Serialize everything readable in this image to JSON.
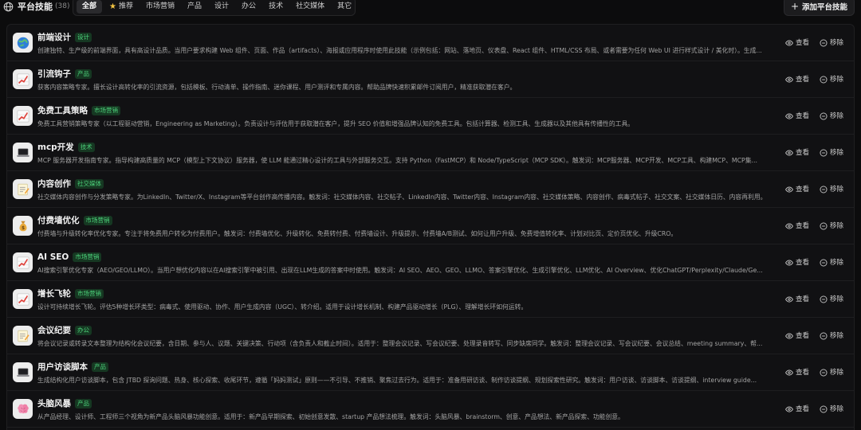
{
  "header": {
    "title": "平台技能",
    "count": "(38)",
    "add_button_label": "添加平台技能"
  },
  "tabs": [
    {
      "label": "全部",
      "active": true,
      "icon": ""
    },
    {
      "label": "推荐",
      "active": false,
      "icon": "star-icon"
    },
    {
      "label": "市场营销",
      "active": false,
      "icon": ""
    },
    {
      "label": "产品",
      "active": false,
      "icon": ""
    },
    {
      "label": "设计",
      "active": false,
      "icon": ""
    },
    {
      "label": "办公",
      "active": false,
      "icon": ""
    },
    {
      "label": "技术",
      "active": false,
      "icon": ""
    },
    {
      "label": "社交媒体",
      "active": false,
      "icon": ""
    },
    {
      "label": "其它",
      "active": false,
      "icon": ""
    }
  ],
  "actions": {
    "view_label": "查看",
    "remove_label": "移除"
  },
  "colors": {
    "background": "#0c0c0d",
    "tag_text": "#4cd17a",
    "tag_bg": "#163822"
  },
  "skills": [
    {
      "name": "前端设计",
      "tag": "设计",
      "icon": "globe-icon",
      "description": "创建独特、生产级的前端界面，具有高设计品质。当用户要求构建 Web 组件、页面、作品（artifacts）、海报或应用程序时使用此技能（示例包括：网站、落地页、仪表盘、React 组件、HTML/CSS 布局、或者需要为任何 Web UI 进行样式设计 / 美化时）。生成..."
    },
    {
      "name": "引流钩子",
      "tag": "产品",
      "icon": "chart-icon",
      "description": "获客内容策略专家。擅长设计高转化率的引流资源，包括模板、行动清单、操作指南、迷你课程、用户测评和专属内容。帮助品牌快速积累邮件订阅用户，精准获取潜在客户。"
    },
    {
      "name": "免费工具策略",
      "tag": "市场营销",
      "icon": "chart-icon",
      "description": "免费工具营销策略专家（以工程驱动营销，Engineering as Marketing）。负责设计与评估用于获取潜在客户，提升 SEO 价值和增强品牌认知的免费工具。包括计算器、检测工具、生成器以及其他具有传播性的工具。"
    },
    {
      "name": "mcp开发",
      "tag": "技术",
      "icon": "laptop-icon",
      "description": "MCP 服务器开发指南专家。指导构建高质量的 MCP（模型上下文协议）服务器，使 LLM 能通过精心设计的工具与外部服务交互。支持 Python（FastMCP）和 Node/TypeScript（MCP SDK）。触发词：MCP服务器、MCP开发、MCP工具、构建MCP、MCP集..."
    },
    {
      "name": "内容创作",
      "tag": "社交媒体",
      "icon": "memo-icon",
      "description": "社交媒体内容创作与分发策略专家。为LinkedIn、Twitter/X、Instagram等平台创作高传播内容。触发词：社交媒体内容、社交帖子、LinkedIn内容、Twitter内容、Instagram内容、社交媒体策略、内容创作、病毒式帖子、社交文案、社交媒体日历、内容再利用。"
    },
    {
      "name": "付费墙优化",
      "tag": "市场营销",
      "icon": "money-bag-icon",
      "description": "付费墙与升级转化率优化专家。专注于将免费用户转化为付费用户。触发词：付费墙优化、升级转化、免费转付费、付费墙设计、升级提示、付费墙A/B测试、如何让用户升级、免费增值转化率、计划对比页、定价页优化、升级CRO。"
    },
    {
      "name": "AI SEO",
      "tag": "市场营销",
      "icon": "chart-icon",
      "description": "AI搜索引擎优化专家（AEO/GEO/LLMO）。当用户想优化内容以在AI搜索引擎中被引用、出现在LLM生成的答案中时使用。触发词：AI SEO、AEO、GEO、LLMO、答案引擎优化、生成引擎优化、LLM优化、AI Overview、优化ChatGPT/Perplexity/Claude/Ge..."
    },
    {
      "name": "增长飞轮",
      "tag": "市场营销",
      "icon": "chart-icon",
      "description": "设计可持续增长飞轮。评估5种增长环类型：病毒式、使用驱动、协作、用户生成内容（UGC）、转介绍。适用于设计增长机制、构建产品驱动增长（PLG）、理解增长环如何运转。"
    },
    {
      "name": "会议纪要",
      "tag": "办公",
      "icon": "memo-icon",
      "description": "将会议记录或转录文本整理为结构化会议纪要，含日期、参与人、议题、关键决策、行动项（含负责人和截止时间）。适用于：整理会议记录、写会议纪要、处理录音转写、同步缺席同学。触发词：整理会议记录、写会议纪要、会议总结、meeting summary、帮..."
    },
    {
      "name": "用户访谈脚本",
      "tag": "产品",
      "icon": "laptop-icon",
      "description": "生成结构化用户访谈脚本，包含 JTBD 探询问题、热身、核心探索、收尾环节，遵循「妈妈测试」原则——不引导、不推销、聚焦过去行为。适用于：准备用研访谈、制作访谈提纲、规划探索性研究。触发词：用户访谈、访谈脚本、访谈提纲、interview guide..."
    },
    {
      "name": "头脑风暴",
      "tag": "产品",
      "icon": "brain-icon",
      "description": "从产品经理、设计师、工程师三个视角为新产品头脑风暴功能创意。适用于：新产品早期探索、初始创意发散、startup 产品想法梳理。触发词：头脑风暴、brainstorm、创意、产品想法、新产品探索、功能创意。"
    }
  ]
}
